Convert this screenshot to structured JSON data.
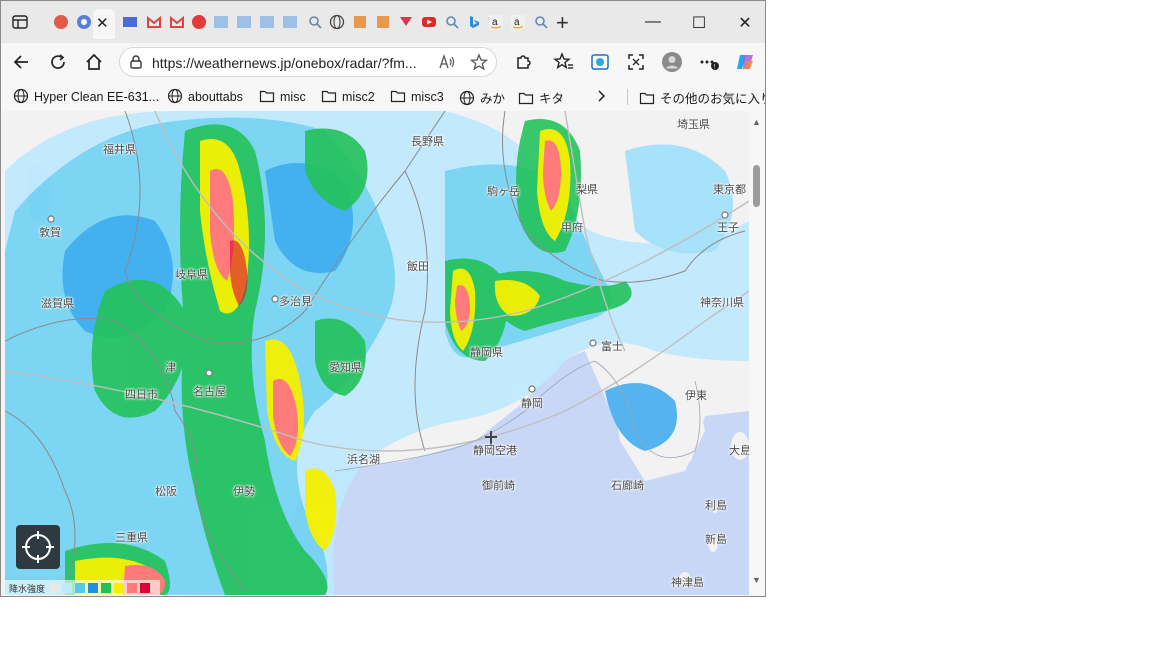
{
  "browser": {
    "address_url": "https://weathernews.jp/onebox/radar/?fm...",
    "bookmarks": [
      {
        "label": "Hyper Clean EE-631...",
        "icon": "globe-icon"
      },
      {
        "label": "abouttabs",
        "icon": "globe-icon"
      },
      {
        "label": "misc",
        "icon": "folder-icon"
      },
      {
        "label": "misc2",
        "icon": "folder-icon"
      },
      {
        "label": "misc3",
        "icon": "folder-icon"
      },
      {
        "label": "みか",
        "icon": "globe-icon"
      },
      {
        "label": "キタ",
        "icon": "folder-icon"
      }
    ],
    "other_favorites": "その他のお気に入り"
  },
  "map": {
    "places": [
      {
        "name": "埼玉県"
      },
      {
        "name": "長野県"
      },
      {
        "name": "福井県"
      },
      {
        "name": "東京都"
      },
      {
        "name": "梨県"
      },
      {
        "name": "駒ヶ岳"
      },
      {
        "name": "敦賀"
      },
      {
        "name": "王子"
      },
      {
        "name": "甲府"
      },
      {
        "name": "飯田"
      },
      {
        "name": "神奈川県"
      },
      {
        "name": "滋賀県"
      },
      {
        "name": "岐阜県"
      },
      {
        "name": "多治見"
      },
      {
        "name": "愛知県"
      },
      {
        "name": "静岡県"
      },
      {
        "name": "富士"
      },
      {
        "name": "津"
      },
      {
        "name": "四日市"
      },
      {
        "name": "静岡"
      },
      {
        "name": "伊東"
      },
      {
        "name": "名古屋"
      },
      {
        "name": "静岡空港"
      },
      {
        "name": "浜名湖"
      },
      {
        "name": "大島"
      },
      {
        "name": "御前崎"
      },
      {
        "name": "石廊崎"
      },
      {
        "name": "松阪"
      },
      {
        "name": "利島"
      },
      {
        "name": "伊勢"
      },
      {
        "name": "新島"
      },
      {
        "name": "三重県"
      },
      {
        "name": "神津島"
      }
    ],
    "legend": {
      "label": "降水強度",
      "colors": [
        "#e8e8e8",
        "#bfe9ff",
        "#55c8f0",
        "#1e8fe6",
        "#1fc25a",
        "#f5f000",
        "#ff7a7a",
        "#e0003a"
      ]
    }
  }
}
